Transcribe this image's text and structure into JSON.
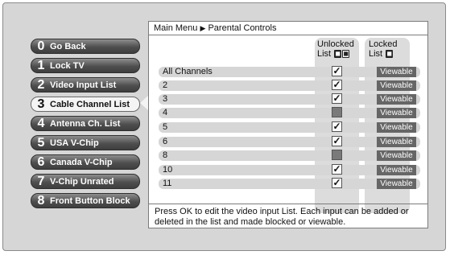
{
  "menu": {
    "items": [
      {
        "number": "0",
        "label": "Go Back"
      },
      {
        "number": "1",
        "label": "Lock TV"
      },
      {
        "number": "2",
        "label": "Video Input List"
      },
      {
        "number": "3",
        "label": "Cable Channel List",
        "selected": true
      },
      {
        "number": "4",
        "label": "Antenna Ch. List"
      },
      {
        "number": "5",
        "label": "USA V-Chip"
      },
      {
        "number": "6",
        "label": "Canada V-Chip"
      },
      {
        "number": "7",
        "label": "V-Chip Unrated"
      },
      {
        "number": "8",
        "label": "Front Button Block"
      }
    ]
  },
  "panel": {
    "breadcrumb": {
      "root": "Main Menu",
      "separator": "▶",
      "current": "Parental Controls"
    },
    "columns": {
      "unlocked": {
        "line1": "Unlocked",
        "line2": "List"
      },
      "locked": {
        "line1": "Locked",
        "line2": "List"
      }
    },
    "channels": [
      {
        "label": "All Channels",
        "checked": true,
        "status": "Viewable"
      },
      {
        "label": "2",
        "checked": true,
        "status": "Viewable"
      },
      {
        "label": "3",
        "checked": true,
        "status": "Viewable"
      },
      {
        "label": "4",
        "checked": false,
        "status": "Viewable"
      },
      {
        "label": "5",
        "checked": true,
        "status": "Viewable"
      },
      {
        "label": "6",
        "checked": true,
        "status": "Viewable"
      },
      {
        "label": "8",
        "checked": false,
        "status": "Viewable"
      },
      {
        "label": "10",
        "checked": true,
        "status": "Viewable"
      },
      {
        "label": "11",
        "checked": true,
        "status": "Viewable"
      }
    ],
    "help_text": "Press OK to edit the video input List. Each input can be added or deleted in the list and made blocked or viewable."
  },
  "icons": {
    "checkmark": "✓",
    "lock": "lock-icon",
    "unlock": "unlock-icon"
  }
}
